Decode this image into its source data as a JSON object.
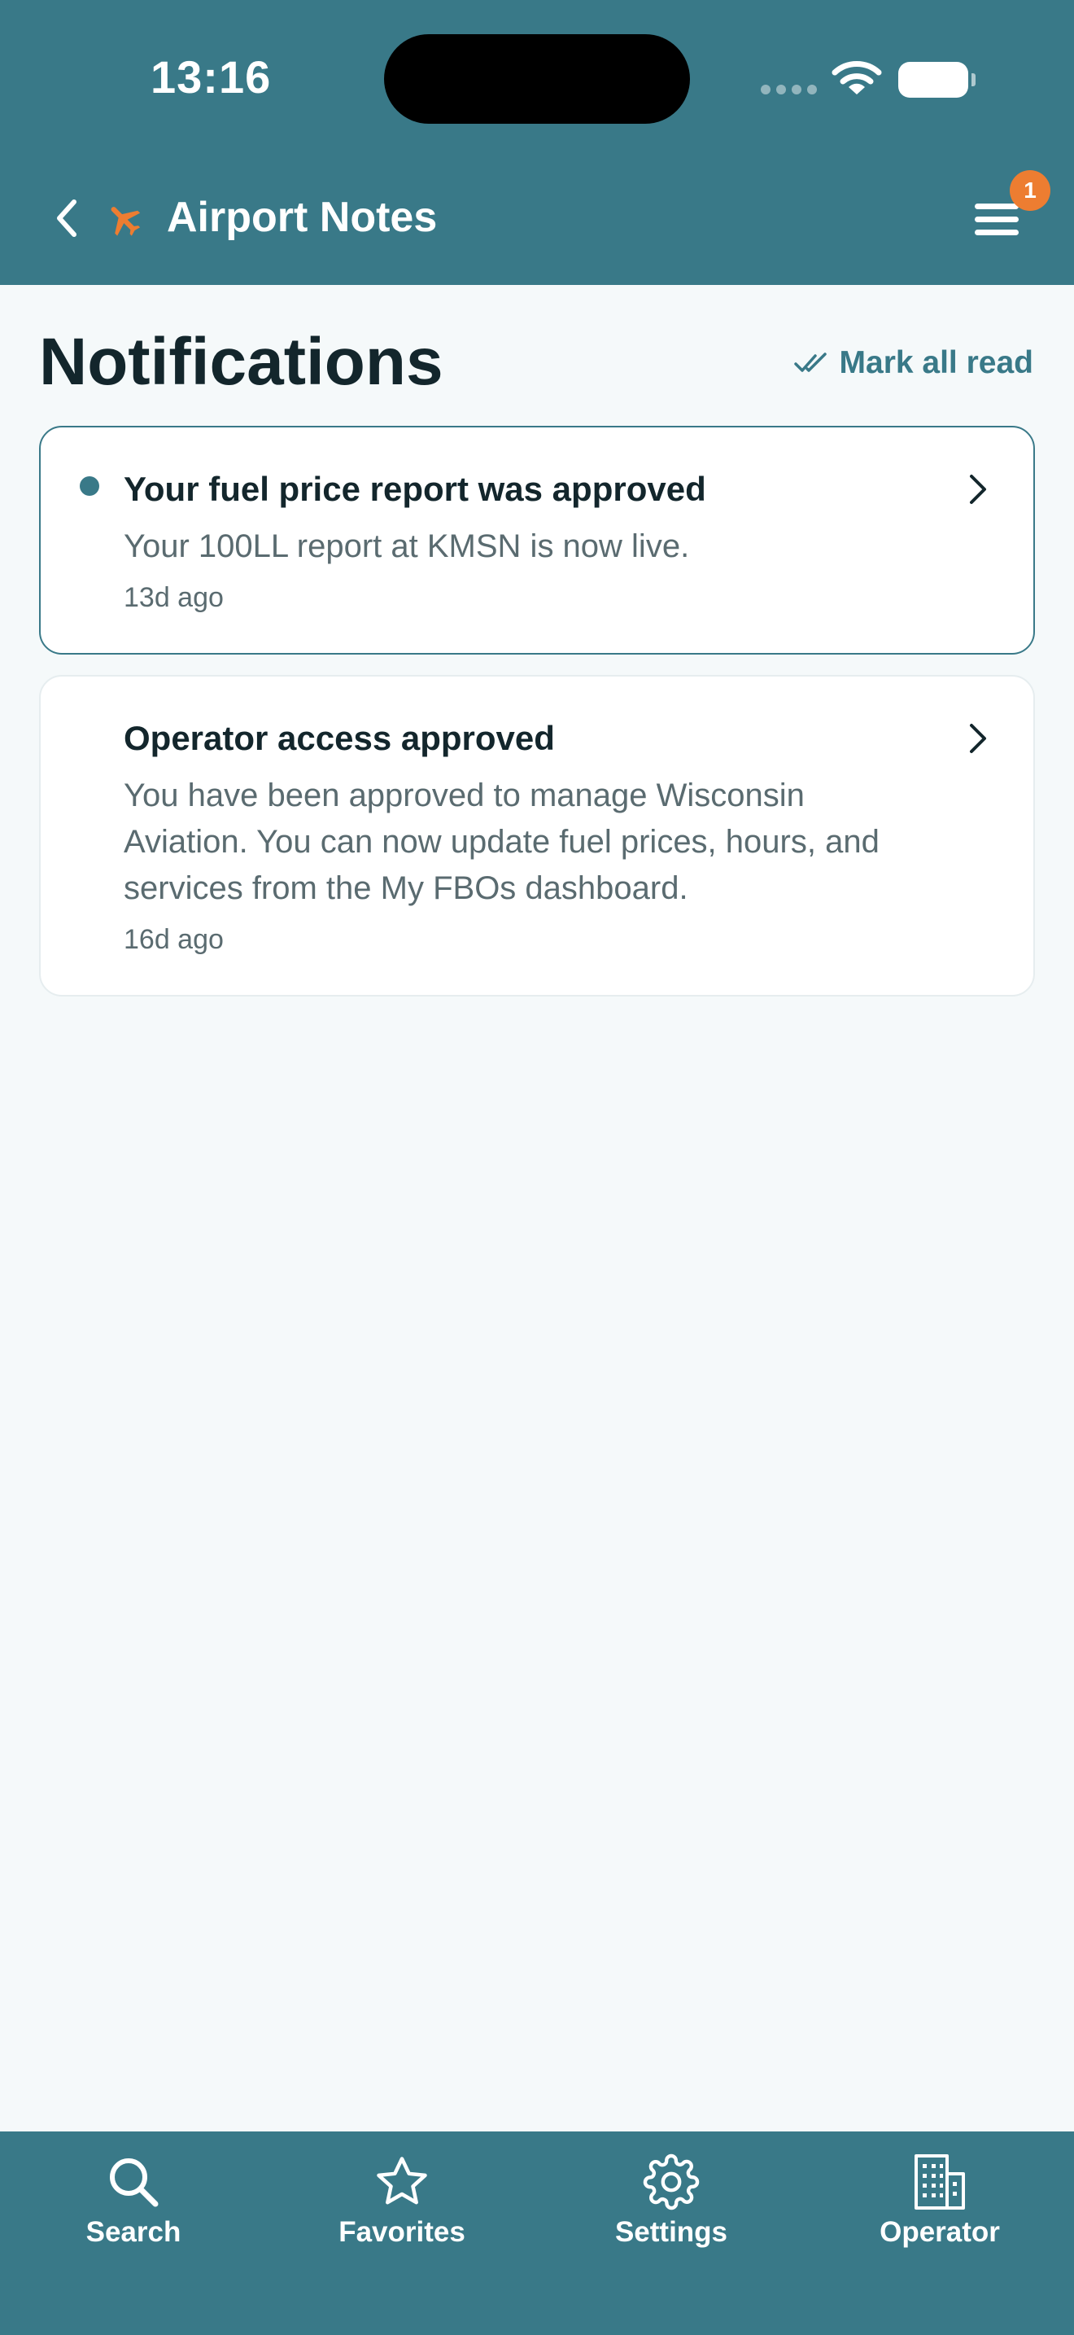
{
  "status_bar": {
    "time": "13:16"
  },
  "header": {
    "title": "Airport Notes",
    "menu_badge": "1",
    "icons": [
      "chevron-left-icon",
      "plane-icon",
      "hamburger-menu-icon"
    ]
  },
  "page": {
    "title": "Notifications",
    "mark_all_read": "Mark all read"
  },
  "notifications": [
    {
      "title": "Your fuel price report was approved",
      "body": "Your 100LL report at KMSN is now live.",
      "time": "13d ago",
      "unread": true
    },
    {
      "title": "Operator access approved",
      "body": "You have been approved to manage Wisconsin Aviation. You can now update fuel prices, hours, and services from the My FBOs dashboard.",
      "time": "16d ago",
      "unread": false
    }
  ],
  "tabbar": {
    "items": [
      {
        "label": "Search",
        "icon": "search-icon"
      },
      {
        "label": "Favorites",
        "icon": "star-icon"
      },
      {
        "label": "Settings",
        "icon": "gear-icon"
      },
      {
        "label": "Operator",
        "icon": "building-icon"
      }
    ]
  },
  "colors": {
    "primary": "#397988",
    "accent": "#ED7D31",
    "background": "#F5F9FA",
    "text_dark": "#13262C",
    "text_muted": "#5A6B70"
  }
}
